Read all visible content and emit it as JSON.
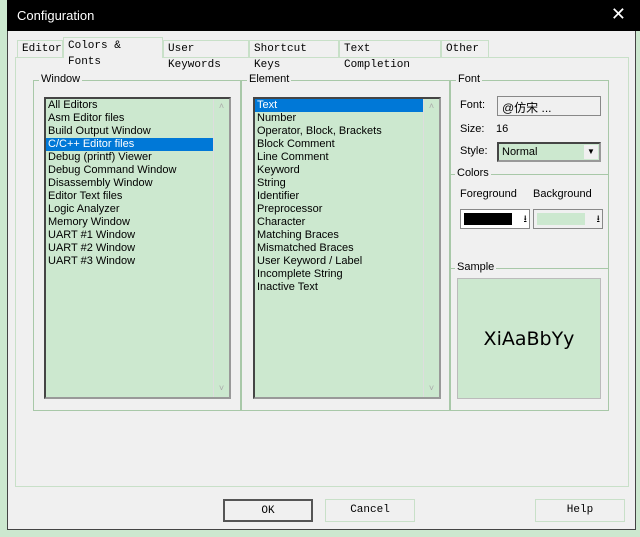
{
  "title": "Configuration",
  "tabs": [
    "Editor",
    "Colors & Fonts",
    "User Keywords",
    "Shortcut Keys",
    "Text Completion",
    "Other"
  ],
  "window_group": {
    "label": "Window",
    "items": [
      "All Editors",
      "Asm Editor files",
      "Build Output Window",
      "C/C++ Editor files",
      "Debug (printf) Viewer",
      "Debug Command Window",
      "Disassembly Window",
      "Editor Text files",
      "Logic Analyzer",
      "Memory Window",
      "UART #1 Window",
      "UART #2 Window",
      "UART #3 Window"
    ],
    "selected": 3
  },
  "element_group": {
    "label": "Element",
    "items": [
      "Text",
      "Number",
      "Operator, Block, Brackets",
      "Block Comment",
      "Line Comment",
      "Keyword",
      "String",
      "Identifier",
      "Preprocessor",
      "Character",
      "Matching Braces",
      "Mismatched Braces",
      "User Keyword / Label",
      "Incomplete String",
      "Inactive Text"
    ],
    "selected": 0
  },
  "font": {
    "label": "Font",
    "font_label": "Font:",
    "font_value": "@仿宋 ...",
    "size_label": "Size:",
    "size_value": "16",
    "style_label": "Style:",
    "style_value": "Normal"
  },
  "colors": {
    "label": "Colors",
    "fg_label": "Foreground",
    "bg_label": "Background",
    "fg": "#000000",
    "bg": "#cce8cf"
  },
  "sample": {
    "label": "Sample",
    "text": "XiAaBbYy"
  },
  "buttons": {
    "ok": "OK",
    "cancel": "Cancel",
    "help": "Help"
  }
}
